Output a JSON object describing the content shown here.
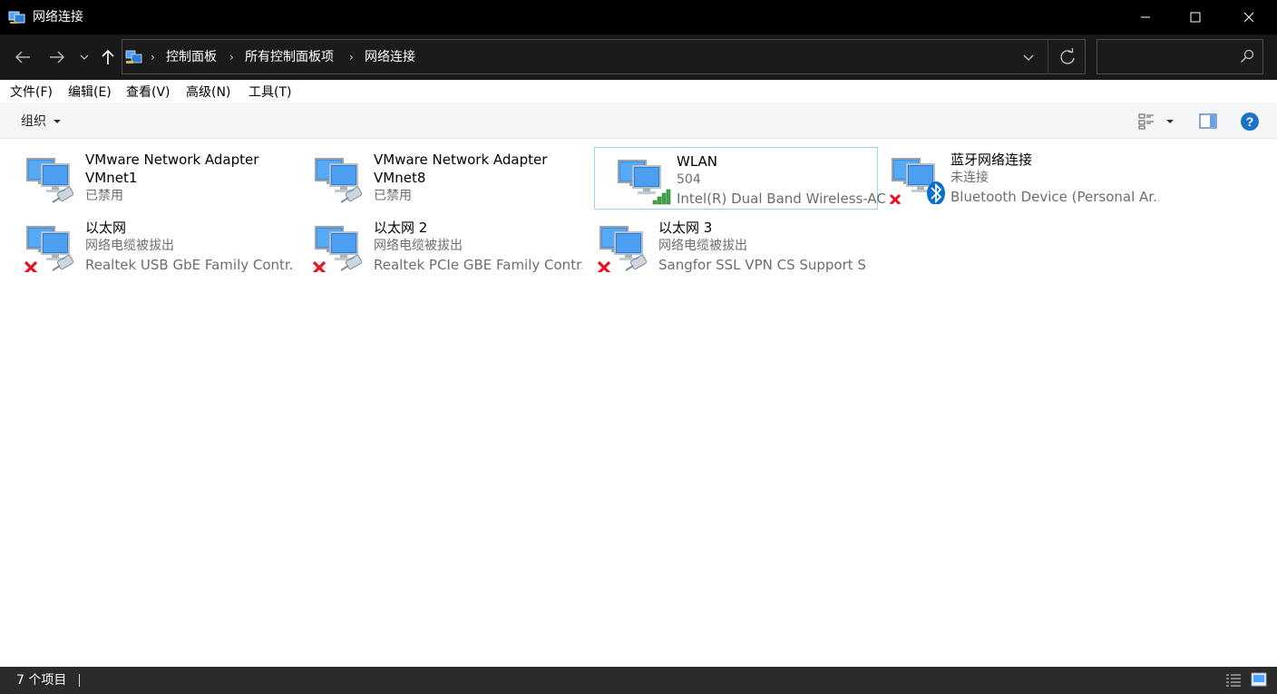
{
  "window": {
    "title": "网络连接",
    "minimize": "minimize-icon",
    "maximize": "maximize-icon",
    "close": "close-icon"
  },
  "nav": {
    "back": "back-arrow-icon",
    "forward": "forward-arrow-icon",
    "recent": "chevron-down-icon",
    "up": "up-arrow-icon",
    "breadcrumb": [
      "控制面板",
      "所有控制面板项",
      "网络连接"
    ],
    "search_placeholder": ""
  },
  "menu": {
    "items": [
      "文件(F)",
      "编辑(E)",
      "查看(V)",
      "高级(N)",
      "工具(T)"
    ]
  },
  "commandbar": {
    "organize": "组织"
  },
  "connections": [
    {
      "name": "VMware Network Adapter VMnet1",
      "status": "已禁用",
      "device": "",
      "overlay": "none",
      "kind": "wired"
    },
    {
      "name": "VMware Network Adapter VMnet8",
      "status": "已禁用",
      "device": "",
      "overlay": "none",
      "kind": "wired"
    },
    {
      "name": "WLAN",
      "status": "504",
      "device": "Intel(R) Dual Band Wireless-AC...",
      "overlay": "signal",
      "kind": "wireless"
    },
    {
      "name": "蓝牙网络连接",
      "status": "未连接",
      "device": "Bluetooth Device (Personal Ar...",
      "overlay": "bluetooth",
      "kind": "bluetooth"
    },
    {
      "name": "以太网",
      "status": "网络电缆被拔出",
      "device": "Realtek USB GbE Family Contr...",
      "overlay": "error",
      "kind": "wired"
    },
    {
      "name": "以太网 2",
      "status": "网络电缆被拔出",
      "device": "Realtek PCIe GBE Family Contr...",
      "overlay": "error",
      "kind": "wired"
    },
    {
      "name": "以太网 3",
      "status": "网络电缆被拔出",
      "device": "Sangfor SSL VPN CS Support S...",
      "overlay": "error",
      "kind": "wired"
    }
  ],
  "statusbar": {
    "count": "7 个项目"
  },
  "colors": {
    "titlebar": "#000000",
    "navbar": "#191919",
    "statusbar": "#2b2b2b",
    "selection_border": "#99d1ff",
    "help_blue": "#1a73c9",
    "error_red": "#e81123",
    "bluetooth_blue": "#0a6ed1"
  }
}
